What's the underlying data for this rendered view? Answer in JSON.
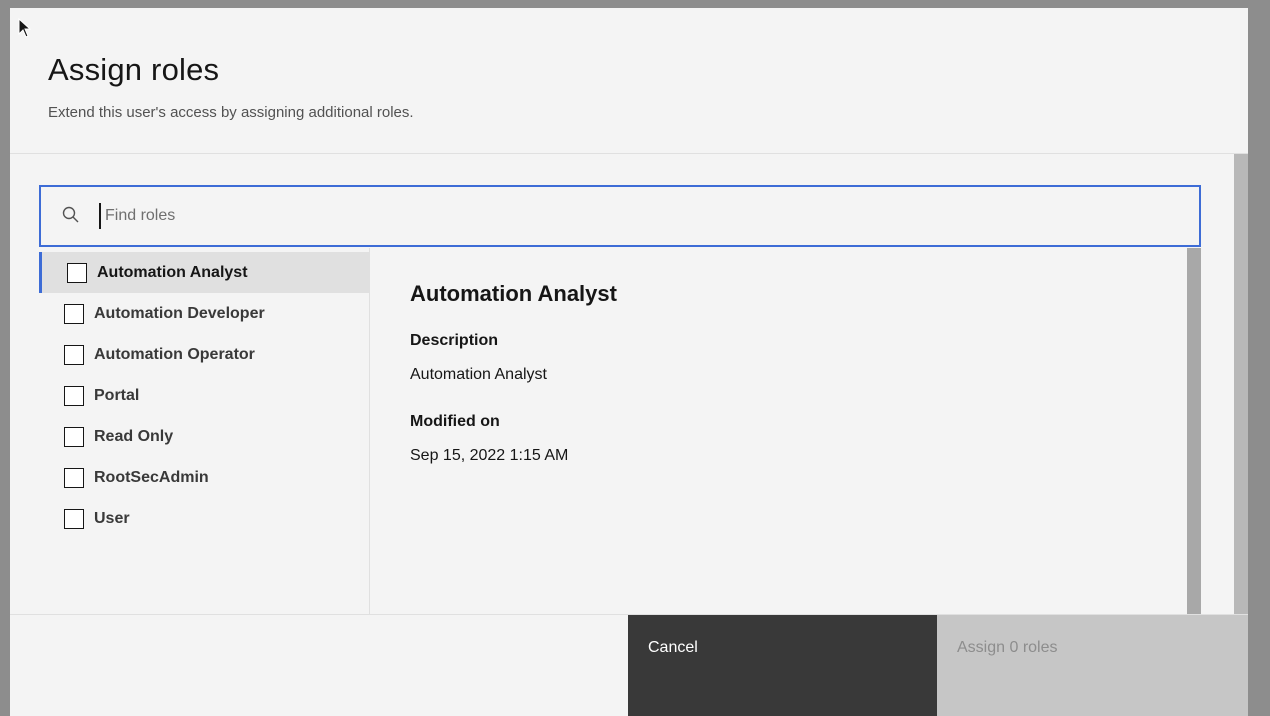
{
  "modal": {
    "title": "Assign roles",
    "subtitle": "Extend this user's access by assigning additional roles."
  },
  "search": {
    "placeholder": "Find roles",
    "value": "",
    "icon": "search-icon"
  },
  "roles": [
    {
      "label": "Automation Analyst",
      "checked": false,
      "selected": true
    },
    {
      "label": "Automation Developer",
      "checked": false,
      "selected": false
    },
    {
      "label": "Automation Operator",
      "checked": false,
      "selected": false
    },
    {
      "label": "Portal",
      "checked": false,
      "selected": false
    },
    {
      "label": "Read Only",
      "checked": false,
      "selected": false
    },
    {
      "label": "RootSecAdmin",
      "checked": false,
      "selected": false
    },
    {
      "label": "User",
      "checked": false,
      "selected": false
    }
  ],
  "detail": {
    "title": "Automation Analyst",
    "description_label": "Description",
    "description_value": "Automation Analyst",
    "modified_label": "Modified on",
    "modified_value": "Sep 15, 2022 1:15 AM"
  },
  "footer": {
    "cancel_label": "Cancel",
    "assign_label": "Assign 0 roles"
  },
  "colors": {
    "accent": "#3d6cd6",
    "cancel_bg": "#393939",
    "assign_disabled_bg": "#c6c6c6"
  }
}
